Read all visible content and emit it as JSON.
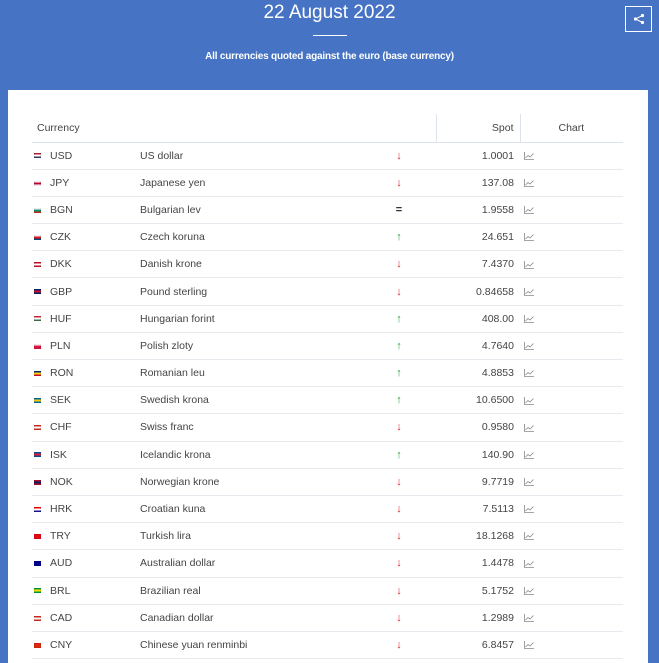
{
  "header": {
    "date": "22 August 2022",
    "subtitle": "All currencies quoted against the euro (base currency)"
  },
  "table": {
    "headers": {
      "currency": "Currency",
      "spot": "Spot",
      "chart": "Chart"
    },
    "rows": [
      {
        "code": "USD",
        "name": "US dollar",
        "trend": "down",
        "spot": "1.0001",
        "flag": [
          "#b22234",
          "#fff",
          "#3c3b6e"
        ]
      },
      {
        "code": "JPY",
        "name": "Japanese yen",
        "trend": "down",
        "spot": "137.08",
        "flag": [
          "#fff",
          "#bc002d",
          "#fff"
        ]
      },
      {
        "code": "BGN",
        "name": "Bulgarian lev",
        "trend": "equal",
        "spot": "1.9558",
        "flag": [
          "#fff",
          "#00966e",
          "#d62612"
        ]
      },
      {
        "code": "CZK",
        "name": "Czech koruna",
        "trend": "up",
        "spot": "24.651",
        "flag": [
          "#fff",
          "#d7141a",
          "#11457e"
        ]
      },
      {
        "code": "DKK",
        "name": "Danish krone",
        "trend": "down",
        "spot": "7.4370",
        "flag": [
          "#c8102e",
          "#fff",
          "#c8102e"
        ]
      },
      {
        "code": "GBP",
        "name": "Pound sterling",
        "trend": "down",
        "spot": "0.84658",
        "flag": [
          "#012169",
          "#c8102e",
          "#012169"
        ]
      },
      {
        "code": "HUF",
        "name": "Hungarian forint",
        "trend": "up",
        "spot": "408.00",
        "flag": [
          "#ce2939",
          "#fff",
          "#477050"
        ]
      },
      {
        "code": "PLN",
        "name": "Polish zloty",
        "trend": "up",
        "spot": "4.7640",
        "flag": [
          "#fff",
          "#dc143c",
          "#dc143c"
        ]
      },
      {
        "code": "RON",
        "name": "Romanian leu",
        "trend": "up",
        "spot": "4.8853",
        "flag": [
          "#002b7f",
          "#fcd116",
          "#ce1126"
        ]
      },
      {
        "code": "SEK",
        "name": "Swedish krona",
        "trend": "up",
        "spot": "10.6500",
        "flag": [
          "#006aa7",
          "#fecc00",
          "#006aa7"
        ]
      },
      {
        "code": "CHF",
        "name": "Swiss franc",
        "trend": "down",
        "spot": "0.9580",
        "flag": [
          "#d52b1e",
          "#fff",
          "#d52b1e"
        ]
      },
      {
        "code": "ISK",
        "name": "Icelandic krona",
        "trend": "up",
        "spot": "140.90",
        "flag": [
          "#02529c",
          "#dc1e35",
          "#02529c"
        ]
      },
      {
        "code": "NOK",
        "name": "Norwegian krone",
        "trend": "down",
        "spot": "9.7719",
        "flag": [
          "#ba0c2f",
          "#00205b",
          "#ba0c2f"
        ]
      },
      {
        "code": "HRK",
        "name": "Croatian kuna",
        "trend": "down",
        "spot": "7.5113",
        "flag": [
          "#ff0000",
          "#fff",
          "#171796"
        ]
      },
      {
        "code": "TRY",
        "name": "Turkish lira",
        "trend": "down",
        "spot": "18.1268",
        "flag": [
          "#e30a17",
          "#e30a17",
          "#e30a17"
        ]
      },
      {
        "code": "AUD",
        "name": "Australian dollar",
        "trend": "down",
        "spot": "1.4478",
        "flag": [
          "#00008b",
          "#00008b",
          "#00008b"
        ]
      },
      {
        "code": "BRL",
        "name": "Brazilian real",
        "trend": "down",
        "spot": "5.1752",
        "flag": [
          "#009c3b",
          "#ffdf00",
          "#009c3b"
        ]
      },
      {
        "code": "CAD",
        "name": "Canadian dollar",
        "trend": "down",
        "spot": "1.2989",
        "flag": [
          "#d52b1e",
          "#fff",
          "#d52b1e"
        ]
      },
      {
        "code": "CNY",
        "name": "Chinese yuan renminbi",
        "trend": "down",
        "spot": "6.8457",
        "flag": [
          "#de2910",
          "#de2910",
          "#de2910"
        ]
      }
    ]
  },
  "icons": {
    "share": "share-icon",
    "trend_down": "arrow-down-icon",
    "trend_up": "arrow-up-icon",
    "trend_equal": "equal-icon",
    "chart": "chart-icon"
  },
  "colors": {
    "background": "#4673c3",
    "trend_down": "#d9242c",
    "trend_up": "#2aa33a"
  }
}
